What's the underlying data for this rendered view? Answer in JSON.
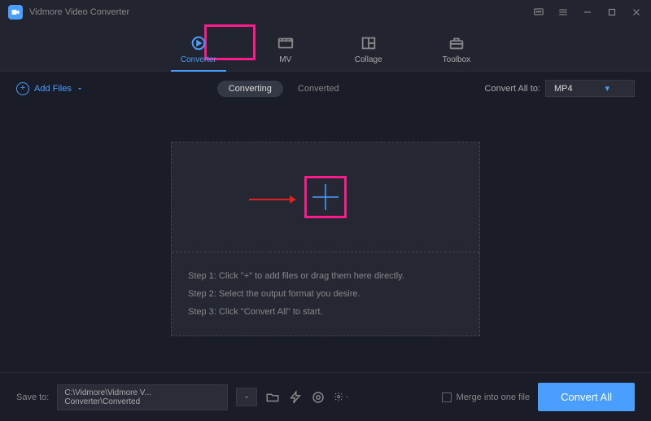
{
  "app": {
    "title": "Vidmore Video Converter"
  },
  "mainTabs": [
    {
      "label": "Converter",
      "active": true
    },
    {
      "label": "MV",
      "active": false
    },
    {
      "label": "Collage",
      "active": false
    },
    {
      "label": "Toolbox",
      "active": false
    }
  ],
  "addFiles": {
    "label": "Add Files"
  },
  "subTabs": [
    {
      "label": "Converting",
      "active": true
    },
    {
      "label": "Converted",
      "active": false
    }
  ],
  "convertAll": {
    "label": "Convert All to:",
    "value": "MP4"
  },
  "dropzone": {
    "step1": "Step 1: Click \"+\" to add files or drag them here directly.",
    "step2": "Step 2: Select the output format you desire.",
    "step3": "Step 3: Click \"Convert All\" to start."
  },
  "footer": {
    "saveToLabel": "Save to:",
    "path": "C:\\Vidmore\\Vidmore V... Converter\\Converted",
    "mergeLabel": "Merge into one file",
    "convertLabel": "Convert All"
  }
}
